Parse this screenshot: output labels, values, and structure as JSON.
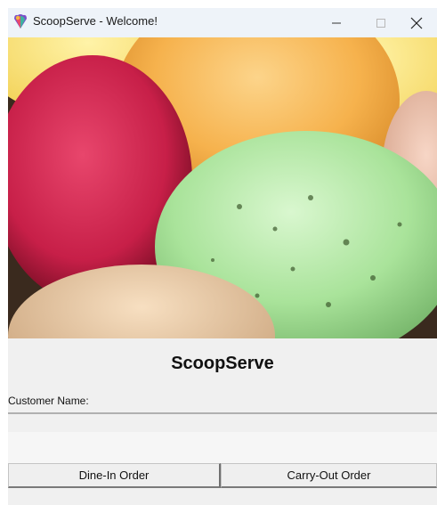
{
  "window": {
    "title": "ScoopServe - Welcome!"
  },
  "hero": {
    "icon": "ice-cream-scoops-image"
  },
  "main": {
    "app_title": "ScoopServe",
    "customer_name_label": "Customer Name:",
    "customer_name_value": ""
  },
  "buttons": {
    "dine_in": "Dine-In Order",
    "carry_out": "Carry-Out Order"
  },
  "colors": {
    "titlebar": "#eef3f9",
    "window_bg": "#f0f0f0"
  }
}
